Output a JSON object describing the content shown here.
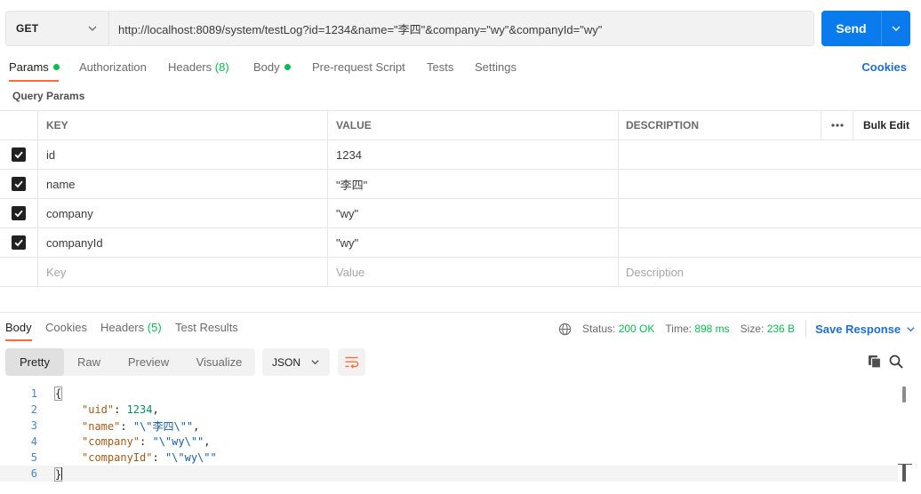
{
  "request": {
    "method": "GET",
    "url": "http://localhost:8089/system/testLog?id=1234&name=\"李四\"&company=\"wy\"&companyId=\"wy\"",
    "send_label": "Send"
  },
  "request_tabs": [
    {
      "label": "Params",
      "active": true,
      "dot": true
    },
    {
      "label": "Authorization"
    },
    {
      "label": "Headers",
      "count": "(8)"
    },
    {
      "label": "Body",
      "dot": true
    },
    {
      "label": "Pre-request Script"
    },
    {
      "label": "Tests"
    },
    {
      "label": "Settings"
    }
  ],
  "cookies_link": "Cookies",
  "query_params_title": "Query Params",
  "params_table": {
    "headers": {
      "key": "KEY",
      "value": "VALUE",
      "description": "DESCRIPTION",
      "bulk_edit": "Bulk Edit"
    },
    "rows": [
      {
        "key": "id",
        "value": "1234",
        "checked": true
      },
      {
        "key": "name",
        "value": "\"李四\"",
        "checked": true
      },
      {
        "key": "company",
        "value": "\"wy\"",
        "checked": true
      },
      {
        "key": "companyId",
        "value": "\"wy\"",
        "checked": true
      }
    ],
    "placeholders": {
      "key": "Key",
      "value": "Value",
      "description": "Description"
    }
  },
  "response_tabs": [
    {
      "label": "Body",
      "active": true
    },
    {
      "label": "Cookies"
    },
    {
      "label": "Headers",
      "count": "(5)"
    },
    {
      "label": "Test Results"
    }
  ],
  "status": {
    "status_label": "Status:",
    "status_value": "200 OK",
    "time_label": "Time:",
    "time_value": "898 ms",
    "size_label": "Size:",
    "size_value": "236 B",
    "save_response": "Save Response"
  },
  "body_view": {
    "modes": [
      "Pretty",
      "Raw",
      "Preview",
      "Visualize"
    ],
    "selected_mode": "Pretty",
    "format": "JSON"
  },
  "code_lines": [
    {
      "n": "1",
      "text": "{"
    },
    {
      "n": "2",
      "key": "\"uid\"",
      "sep": ": ",
      "val": "1234",
      "tail": ","
    },
    {
      "n": "3",
      "key": "\"name\"",
      "sep": ": ",
      "val": "\"\\\"李四\\\"\"",
      "tail": ","
    },
    {
      "n": "4",
      "key": "\"company\"",
      "sep": ": ",
      "val": "\"\\\"wy\\\"\"",
      "tail": ","
    },
    {
      "n": "5",
      "key": "\"companyId\"",
      "sep": ": ",
      "val": "\"\\\"wy\\\"\"",
      "tail": ""
    },
    {
      "n": "6",
      "text": "}"
    }
  ],
  "colors": {
    "accent": "#097bed",
    "active_tab": "#ff6c37",
    "ok": "#0cbb52",
    "link": "#1f6ed1"
  },
  "icons": [
    "chevron-down-icon",
    "globe-icon",
    "wrap-lines-icon",
    "copy-icon",
    "search-icon",
    "more-icon",
    "checkbox-checked-icon"
  ]
}
